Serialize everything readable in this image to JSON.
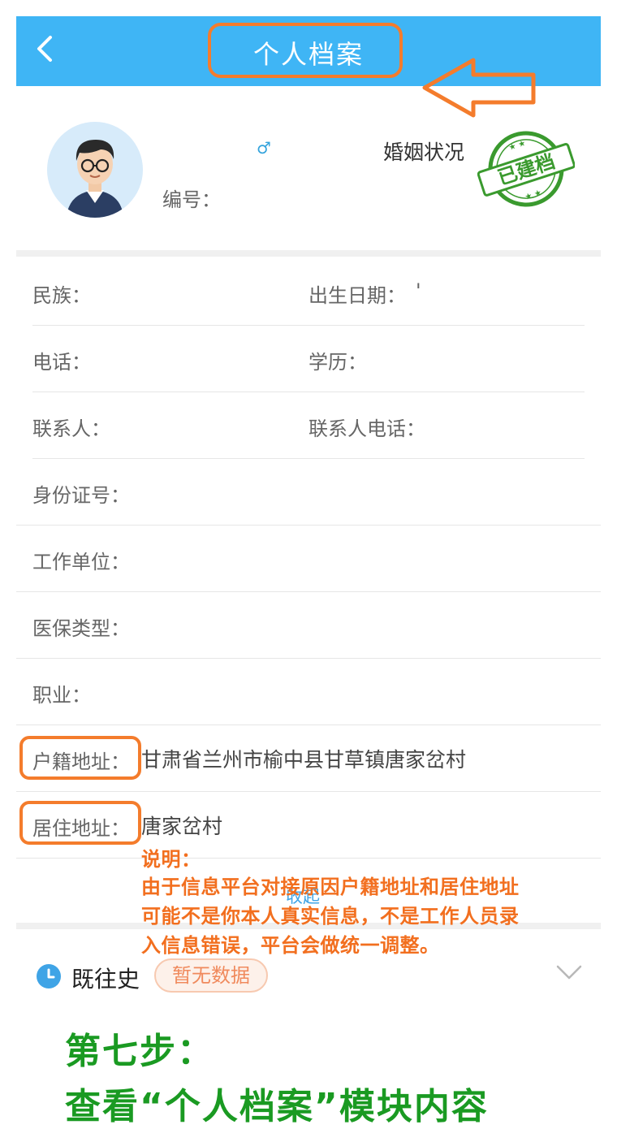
{
  "header": {
    "title": "个人档案"
  },
  "profile": {
    "gender_symbol": "♂",
    "marriage_label": "婚姻状况",
    "number_label": "编号：",
    "stamp_text": "已建档"
  },
  "fields": {
    "ethnicity": "民族：",
    "birth_date": "出生日期：",
    "birth_value": "'",
    "phone": "电话：",
    "education": "学历：",
    "contact": "联系人：",
    "contact_phone": "联系人电话：",
    "id_number": "身份证号：",
    "workplace": "工作单位：",
    "insurance": "医保类型：",
    "occupation": "职业：",
    "household_label": "户籍地址：",
    "household_value": "甘肃省兰州市榆中县甘草镇唐家岔村",
    "residence_label": "居住地址：",
    "residence_value": "唐家岔村"
  },
  "collapse_label": "收起",
  "history": {
    "title": "既往史",
    "badge": "暂无数据"
  },
  "annotation": {
    "explain_title": "说明：",
    "explain_lines": [
      "由于信息平台对接原因户籍地址和居住地址",
      "可能不是你本人真实信息，不是工作人员录",
      "入信息错误，平台会做统一调整。"
    ],
    "step_line1": "第七步：",
    "step_line2": "查看“个人档案”模块内容"
  },
  "colors": {
    "header_bg": "#3fb5f5",
    "accent_orange": "#f47c2c",
    "stamp_green": "#3a9a2e",
    "step_green": "#1a9a22"
  }
}
